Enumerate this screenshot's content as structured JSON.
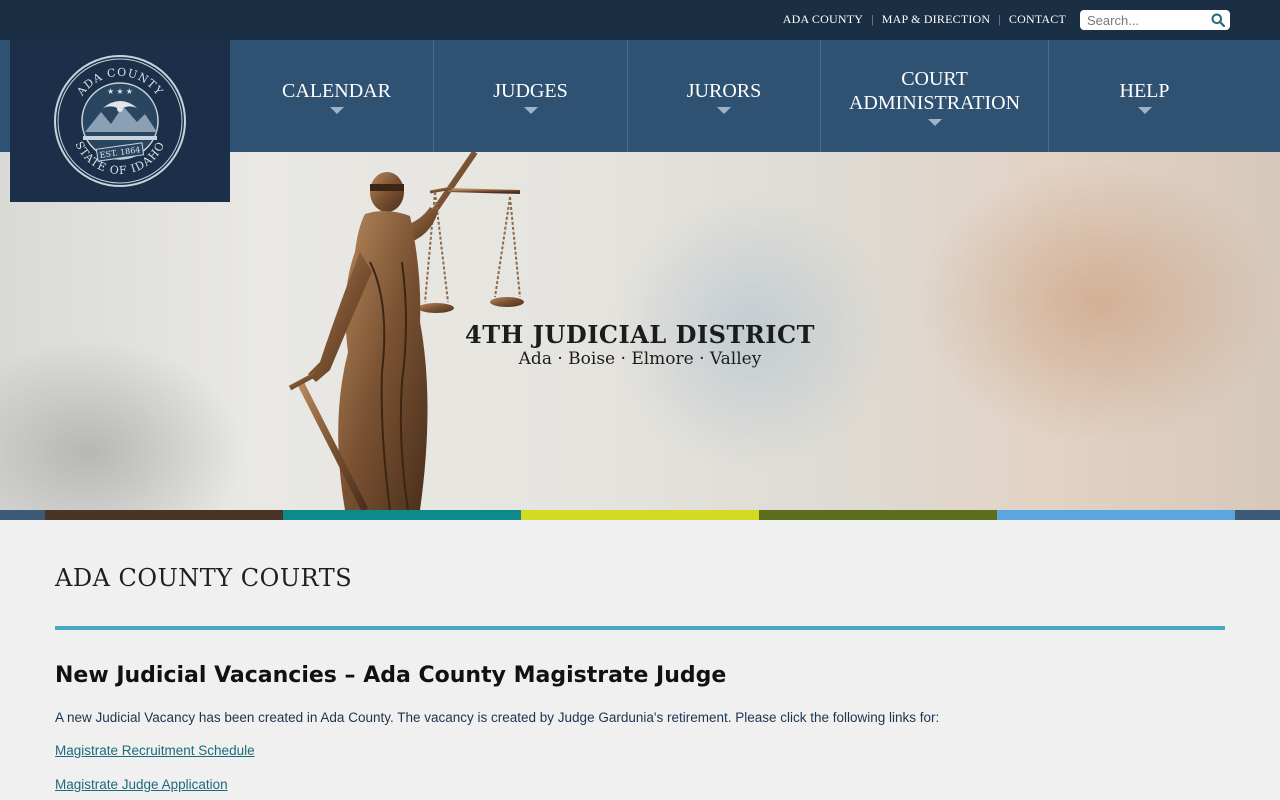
{
  "topbar": {
    "links": [
      "ADA COUNTY",
      "MAP & DIRECTION",
      "CONTACT"
    ],
    "search_placeholder": "Search..."
  },
  "nav": {
    "items": [
      {
        "label": "CALENDAR"
      },
      {
        "label": "JUDGES"
      },
      {
        "label": "JURORS"
      },
      {
        "label": "COURT ADMINISTRATION"
      },
      {
        "label": "HELP"
      }
    ]
  },
  "logo": {
    "seal_text_top": "ADA COUNTY",
    "seal_text_bottom": "STATE OF IDAHO",
    "seal_est": "EST. 1864"
  },
  "hero": {
    "title": "4TH JUDICIAL DISTRICT",
    "subtitle": "Ada · Boise · Elmore · Valley"
  },
  "colors": {
    "topbar": "#1a2e44",
    "nav": "#2f5273",
    "accent_rule": "#4aa7c7",
    "stripe": [
      "#3d5a77",
      "#4b3325",
      "#0f8a8a",
      "#d2db22",
      "#5c6d1e",
      "#5aa7e0",
      "#3d5a77"
    ]
  },
  "main": {
    "page_title": "ADA COUNTY COURTS",
    "news_title": "New Judicial Vacancies – Ada County Magistrate Judge",
    "news_body": "A new Judicial Vacancy has been created in Ada County.  The vacancy is created by Judge Gardunia's retirement.  Please click the following links for:",
    "links": [
      "Magistrate Recruitment Schedule",
      "Magistrate Judge Application"
    ]
  }
}
